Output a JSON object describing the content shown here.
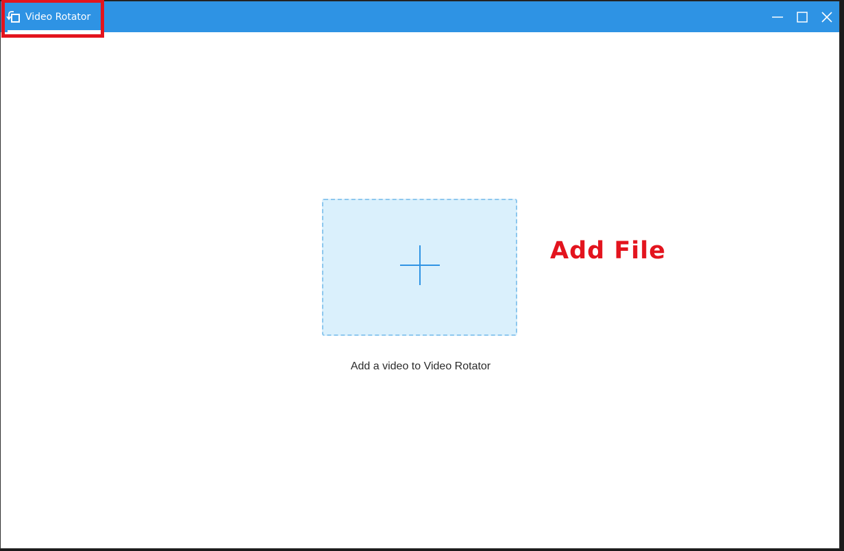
{
  "window": {
    "title": "Video Rotator",
    "accent_color": "#2e93e4"
  },
  "controls": {
    "minimize_icon": "minimize-icon",
    "maximize_icon": "maximize-icon",
    "close_icon": "close-icon"
  },
  "main": {
    "dropzone_icon": "plus-icon",
    "hint": "Add a video to Video Rotator"
  },
  "annotation": {
    "label": "Add File",
    "color": "#e3141e"
  }
}
